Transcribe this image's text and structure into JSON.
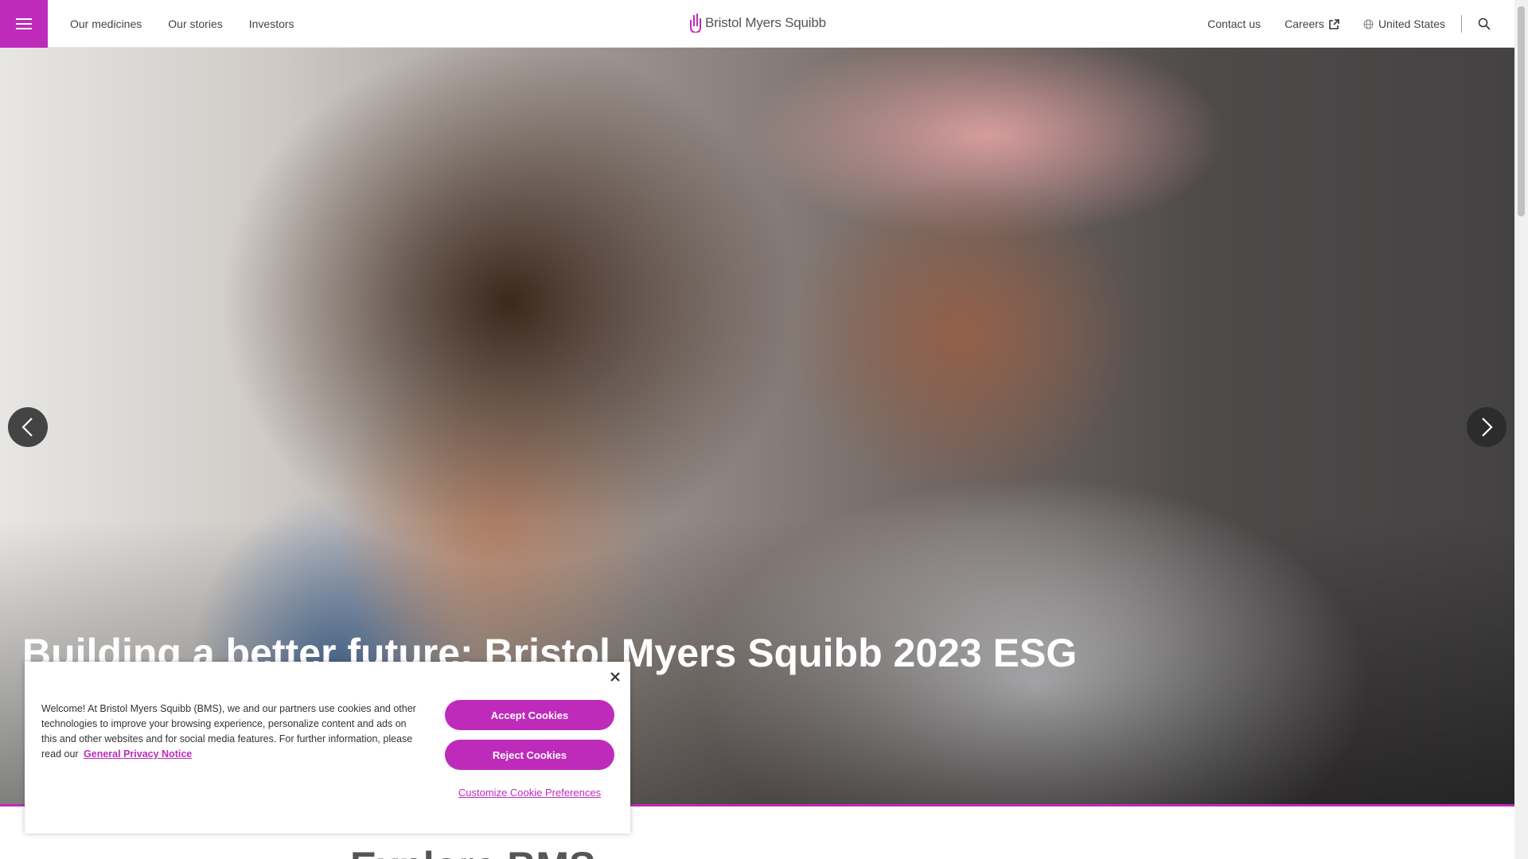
{
  "header": {
    "menu_icon": "hamburger-icon",
    "nav_left": [
      "Our medicines",
      "Our stories",
      "Investors"
    ],
    "logo_text": "Bristol Myers Squibb",
    "nav_right": {
      "contact": "Contact us",
      "careers": "Careers",
      "region": "United States"
    },
    "icons": {
      "careers": "external-link-icon",
      "region": "globe-icon",
      "search": "search-icon"
    }
  },
  "hero": {
    "title": "Building a better future: Bristol Myers Squibb 2023 ESG",
    "prev_icon": "chevron-left-icon",
    "next_icon": "chevron-right-icon"
  },
  "section": {
    "heading": "Explore BMS"
  },
  "cookie_banner": {
    "text": "Welcome! At Bristol Myers Squibb (BMS), we and our partners use cookies and other technologies to improve your browsing experience, personalize content and ads on this and other websites and for social media features. For further information, please read our",
    "privacy_link": "General Privacy Notice",
    "accept": "Accept Cookies",
    "reject": "Reject Cookies",
    "customize": "Customize Cookie Preferences"
  },
  "colors": {
    "brand": "#be2bbb",
    "text": "#333333"
  }
}
